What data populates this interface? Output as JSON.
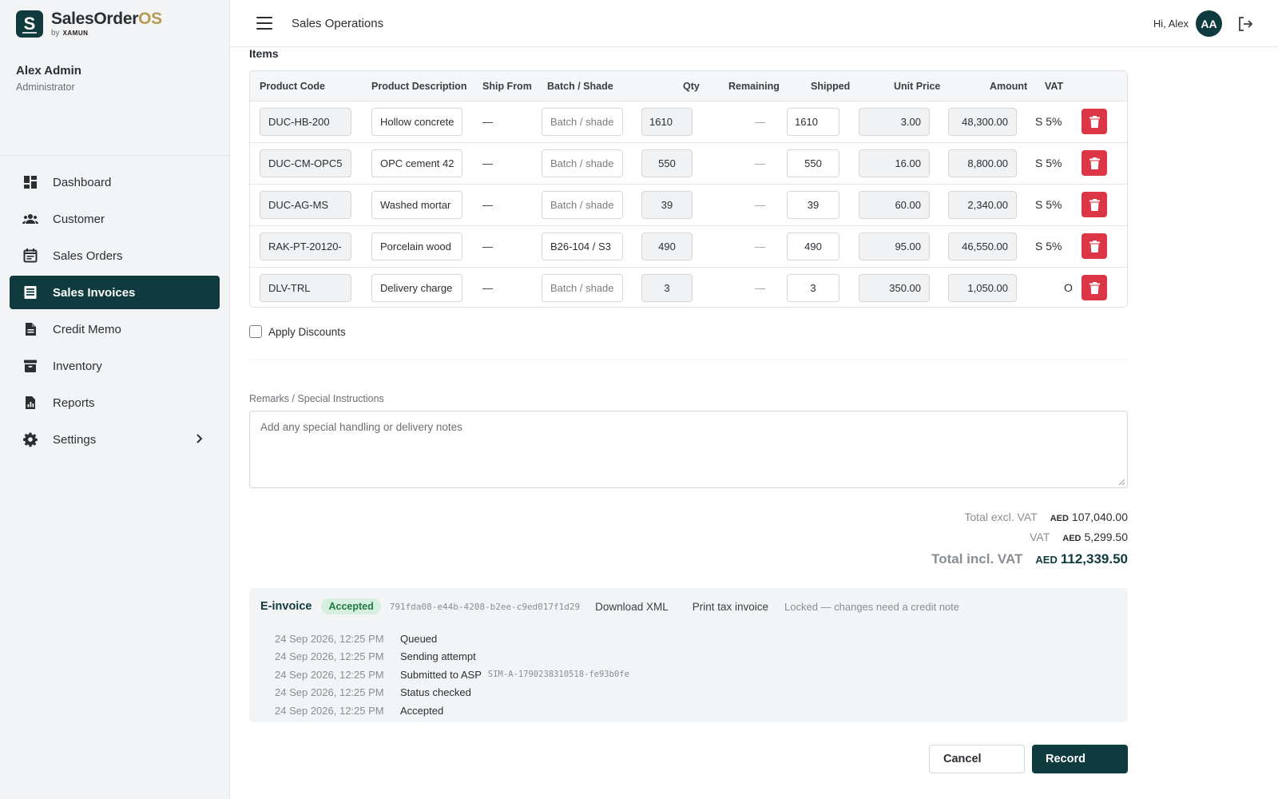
{
  "brand": {
    "name_main": "SalesOrder",
    "name_accent": "OS",
    "logo_letter": "S",
    "by_text": "by",
    "by_brand": "XAMUN"
  },
  "user": {
    "name": "Alex Admin",
    "role": "Administrator"
  },
  "nav": [
    {
      "label": "Dashboard",
      "icon": "dashboard-icon",
      "active": false
    },
    {
      "label": "Customer",
      "icon": "people-icon",
      "active": false
    },
    {
      "label": "Sales Orders",
      "icon": "calendar-icon",
      "active": false
    },
    {
      "label": "Sales Invoices",
      "icon": "invoice-icon",
      "active": true
    },
    {
      "label": "Credit Memo",
      "icon": "document-icon",
      "active": false
    },
    {
      "label": "Inventory",
      "icon": "archive-icon",
      "active": false
    },
    {
      "label": "Reports",
      "icon": "report-icon",
      "active": false
    },
    {
      "label": "Settings",
      "icon": "gear-icon",
      "active": false
    }
  ],
  "topbar": {
    "title": "Sales Operations",
    "greeting": "Hi, Alex",
    "avatar": "AA"
  },
  "items": {
    "title": "Items",
    "headers": {
      "code": "Product Code",
      "desc": "Product Description",
      "ship": "Ship From",
      "batch": "Batch / Shade",
      "qty": "Qty",
      "remaining": "Remaining",
      "shipped": "Shipped",
      "price": "Unit Price",
      "amount": "Amount",
      "vat": "VAT"
    },
    "batch_placeholder": "Batch / shade",
    "rows": [
      {
        "code": "DUC-HB-200",
        "desc": "Hollow concrete",
        "ship": "—",
        "batch": "",
        "qty": "1610",
        "remaining": "—",
        "shipped": "1610",
        "price": "3.00",
        "amount": "48,300.00",
        "vat": "S 5%"
      },
      {
        "code": "DUC-CM-OPC5",
        "desc": "OPC cement 42",
        "ship": "—",
        "batch": "",
        "qty": "550",
        "remaining": "—",
        "shipped": "550",
        "price": "16.00",
        "amount": "8,800.00",
        "vat": "S 5%"
      },
      {
        "code": "DUC-AG-MS",
        "desc": "Washed mortar",
        "ship": "—",
        "batch": "",
        "qty": "39",
        "remaining": "—",
        "shipped": "39",
        "price": "60.00",
        "amount": "2,340.00",
        "vat": "S 5%"
      },
      {
        "code": "RAK-PT-20120-",
        "desc": "Porcelain wood",
        "ship": "—",
        "batch": "B26-104 / S3",
        "qty": "490",
        "remaining": "—",
        "shipped": "490",
        "price": "95.00",
        "amount": "46,550.00",
        "vat": "S 5%"
      },
      {
        "code": "DLV-TRL",
        "desc": "Delivery charge",
        "ship": "—",
        "batch": "",
        "qty": "3",
        "remaining": "—",
        "shipped": "3",
        "price": "350.00",
        "amount": "1,050.00",
        "vat": "O"
      }
    ]
  },
  "discounts": {
    "label": "Apply Discounts",
    "checked": false
  },
  "remarks": {
    "label": "Remarks / Special Instructions",
    "placeholder": "Add any special handling or delivery notes"
  },
  "totals": {
    "currency": "AED",
    "excl_label": "Total excl. VAT",
    "excl_value": "107,040.00",
    "vat_label": "VAT",
    "vat_value": "5,299.50",
    "incl_label": "Total incl. VAT",
    "incl_value": "112,339.50"
  },
  "einvoice": {
    "title": "E-invoice",
    "status": "Accepted",
    "uuid": "791fda08-e44b-4208-b2ee-c9ed017f1d29",
    "download_label": "Download XML",
    "print_label": "Print tax invoice",
    "locked_note": "Locked — changes need a credit note",
    "log": [
      {
        "time": "24 Sep 2026, 12:25 PM",
        "event": "Queued",
        "ref": ""
      },
      {
        "time": "24 Sep 2026, 12:25 PM",
        "event": "Sending attempt",
        "ref": ""
      },
      {
        "time": "24 Sep 2026, 12:25 PM",
        "event": "Submitted to ASP",
        "ref": "SIM-A-1790238310518-fe93b0fe"
      },
      {
        "time": "24 Sep 2026, 12:25 PM",
        "event": "Status checked",
        "ref": ""
      },
      {
        "time": "24 Sep 2026, 12:25 PM",
        "event": "Accepted",
        "ref": ""
      }
    ]
  },
  "actions": {
    "cancel": "Cancel",
    "record": "Record"
  },
  "colors": {
    "brand": "#0f3b3e",
    "accent_gold": "#b89a55",
    "danger": "#dc3545",
    "success_bg": "#d7efdf",
    "success_fg": "#1f7a43"
  }
}
